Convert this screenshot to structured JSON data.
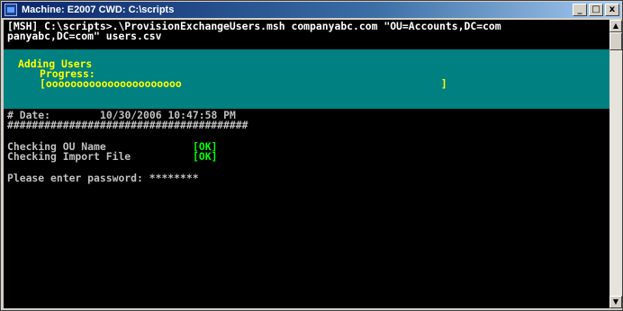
{
  "window": {
    "title": "Machine: E2007 CWD: C:\\scripts",
    "controls": {
      "minimize": "_",
      "maximize": "□",
      "close": "x"
    }
  },
  "console": {
    "prompt_prefix": "[MSH]",
    "command_line_1": " C:\\scripts>.\\ProvisionExchangeUsers.msh companyabc.com \"OU=Accounts,DC=com",
    "command_line_2": "panyabc,DC=com\" users.csv",
    "progress": {
      "activity": "Adding Users",
      "label": "Progress:",
      "bar_text": "[oooooooooooooooooooooo                                          ]",
      "background": "#008080",
      "text_color": "#ffff00"
    },
    "date_label": "# Date:",
    "date_value": "10/30/2006 10:47:58 PM",
    "separator": "#######################################",
    "checks": [
      {
        "label": "Checking OU Name",
        "status": "[OK]"
      },
      {
        "label": "Checking Import File",
        "status": "[OK]"
      }
    ],
    "password_prompt": "Please enter password: ",
    "password_mask": "********"
  },
  "scrollbar": {
    "up_arrow": "▲",
    "down_arrow": "▼"
  }
}
